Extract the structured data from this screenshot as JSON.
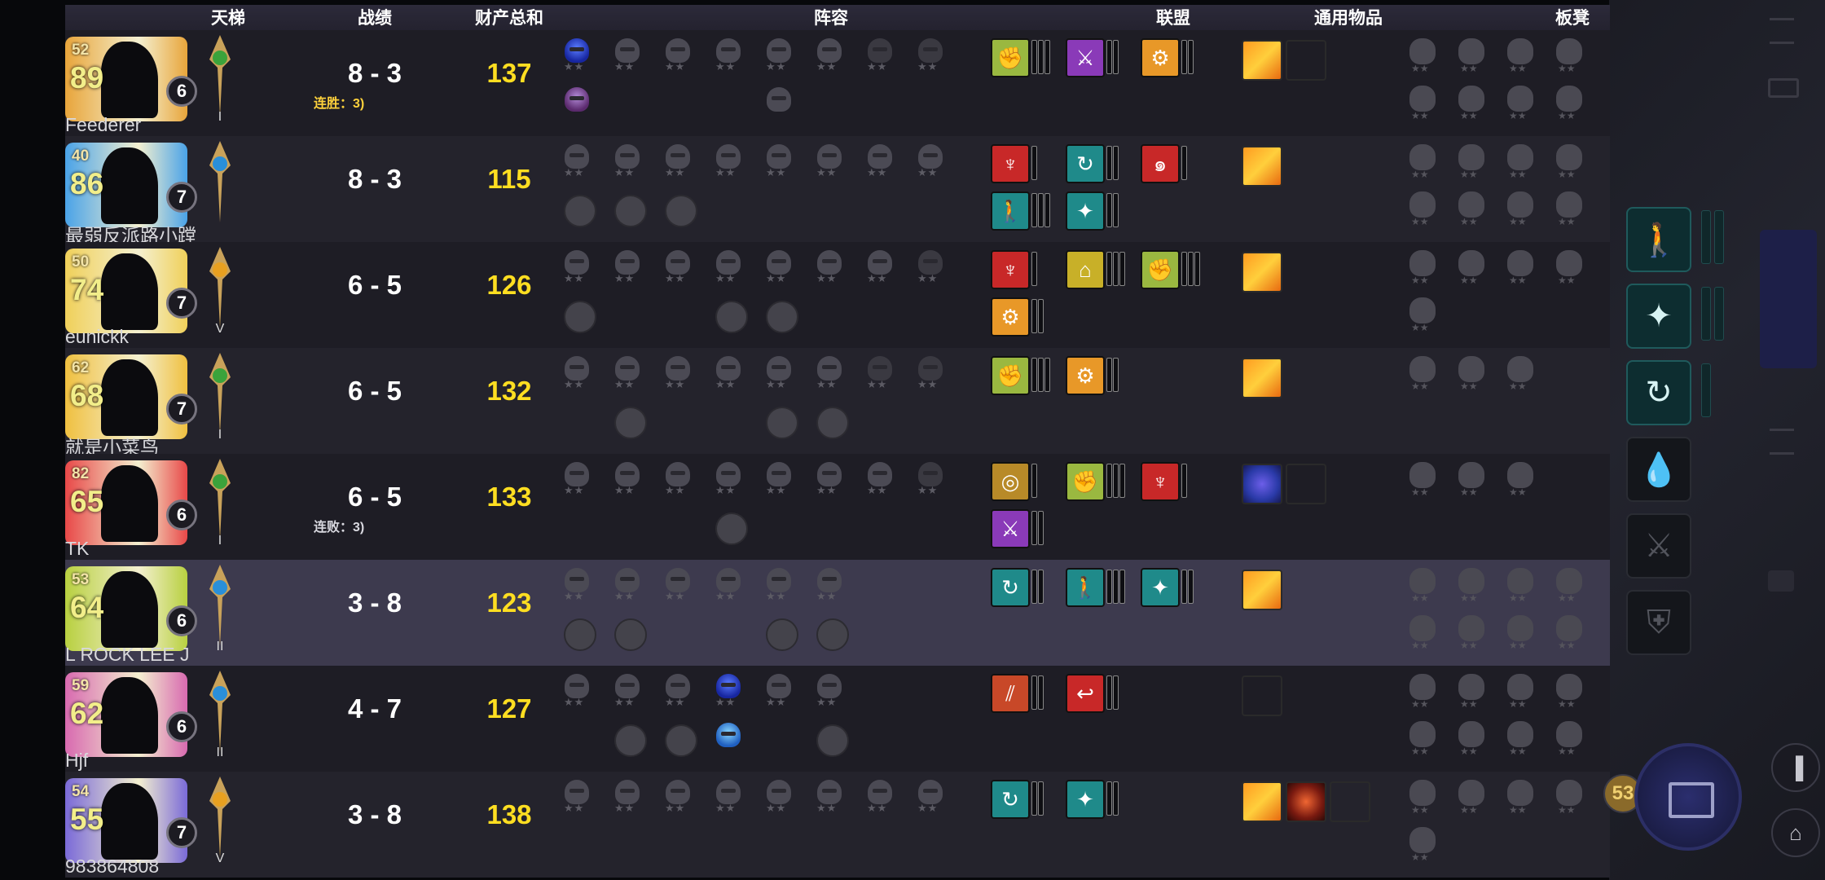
{
  "header": {
    "ladder": "天梯",
    "record": "战绩",
    "networth": "财产总和",
    "lineup": "阵容",
    "alliances": "联盟",
    "items": "通用物品",
    "bench": "板凳"
  },
  "players": [
    {
      "name": "Feederer",
      "gold": "52",
      "hp": "89",
      "level": "6",
      "rank_num": "I",
      "record": "8 - 3",
      "streak": "连胜：3)",
      "streak_type": "win",
      "networth": "137",
      "avatar_color": "#e8a53b",
      "rank_color": "#3ba33b"
    },
    {
      "name": "最弱反派路小蹚",
      "gold": "40",
      "hp": "86",
      "level": "7",
      "rank_num": "",
      "record": "8 - 3",
      "streak": "",
      "streak_type": "",
      "networth": "115",
      "avatar_color": "#4aa3e8",
      "rank_color": "#2a8fd9"
    },
    {
      "name": "eunickk",
      "gold": "50",
      "hp": "74",
      "level": "7",
      "rank_num": "V",
      "record": "6 - 5",
      "streak": "",
      "streak_type": "",
      "networth": "126",
      "avatar_color": "#f0d05a",
      "rank_color": "#e8a020"
    },
    {
      "name": "就是小菜鸟",
      "gold": "62",
      "hp": "68",
      "level": "7",
      "rank_num": "I",
      "record": "6 - 5",
      "streak": "",
      "streak_type": "",
      "networth": "132",
      "avatar_color": "#f0c040",
      "rank_color": "#3ba33b"
    },
    {
      "name": "TK",
      "gold": "82",
      "hp": "65",
      "level": "6",
      "rank_num": "I",
      "record": "6 - 5",
      "streak": "连败：3)",
      "streak_type": "lose",
      "networth": "133",
      "avatar_color": "#e84848",
      "rank_color": "#3ba33b"
    },
    {
      "name": "L ROCK LEE J",
      "gold": "53",
      "hp": "64",
      "level": "6",
      "rank_num": "II",
      "record": "3 - 8",
      "streak": "",
      "streak_type": "",
      "networth": "123",
      "avatar_color": "#b8d040",
      "rank_color": "#2a8fd9"
    },
    {
      "name": "Hjf",
      "gold": "59",
      "hp": "62",
      "level": "6",
      "rank_num": "II",
      "record": "4 - 7",
      "streak": "",
      "streak_type": "",
      "networth": "127",
      "avatar_color": "#d86ab0",
      "rank_color": "#2a8fd9"
    },
    {
      "name": "983864808",
      "gold": "54",
      "hp": "55",
      "level": "7",
      "rank_num": "V",
      "record": "3 - 8",
      "streak": "",
      "streak_type": "",
      "networth": "138",
      "avatar_color": "#7a6ad8",
      "rank_color": "#e8a020"
    }
  ],
  "shop_gold": "53"
}
